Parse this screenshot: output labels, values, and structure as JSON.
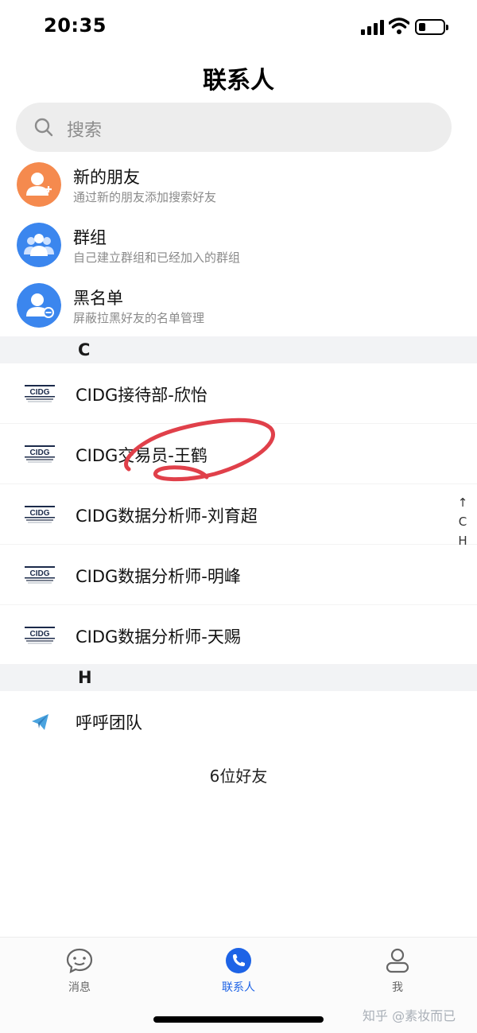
{
  "status_bar": {
    "time": "20:35"
  },
  "header": {
    "title": "联系人"
  },
  "search": {
    "placeholder": "搜索"
  },
  "menu_items": [
    {
      "title": "新的朋友",
      "subtitle": "通过新的朋友添加搜索好友",
      "icon": "add-friend-icon",
      "color": "#f58a4e"
    },
    {
      "title": "群组",
      "subtitle": "自己建立群组和已经加入的群组",
      "icon": "group-icon",
      "color": "#3b86ee"
    },
    {
      "title": "黑名单",
      "subtitle": "屏蔽拉黑好友的名单管理",
      "icon": "blocklist-icon",
      "color": "#3b86ee"
    }
  ],
  "sections": [
    {
      "letter": "C",
      "contacts": [
        {
          "name": "CIDG接待部-欣怡",
          "logo": "cidg-logo"
        },
        {
          "name": "CIDG交易员-王鹤",
          "logo": "cidg-logo"
        },
        {
          "name": "CIDG数据分析师-刘育超",
          "logo": "cidg-logo"
        },
        {
          "name": "CIDG数据分析师-明峰",
          "logo": "cidg-logo"
        },
        {
          "name": "CIDG数据分析师-天赐",
          "logo": "cidg-logo"
        }
      ]
    },
    {
      "letter": "H",
      "contacts": [
        {
          "name": "呼呼团队",
          "logo": "paper-plane-icon"
        }
      ]
    }
  ],
  "index_bar": {
    "arrow": "↑",
    "letters": [
      "C",
      "H"
    ]
  },
  "footer": {
    "count_text": "6位好友"
  },
  "tab_bar": {
    "tabs": [
      {
        "label": "消息",
        "icon": "chat-bubble-icon",
        "active": false
      },
      {
        "label": "联系人",
        "icon": "phone-icon",
        "active": true
      },
      {
        "label": "我",
        "icon": "person-icon",
        "active": false
      }
    ]
  },
  "watermark": "知乎 @素妆而已",
  "colors": {
    "accent": "#1d63e6",
    "annotation": "#e0404a",
    "section_bg": "#f2f3f5"
  }
}
